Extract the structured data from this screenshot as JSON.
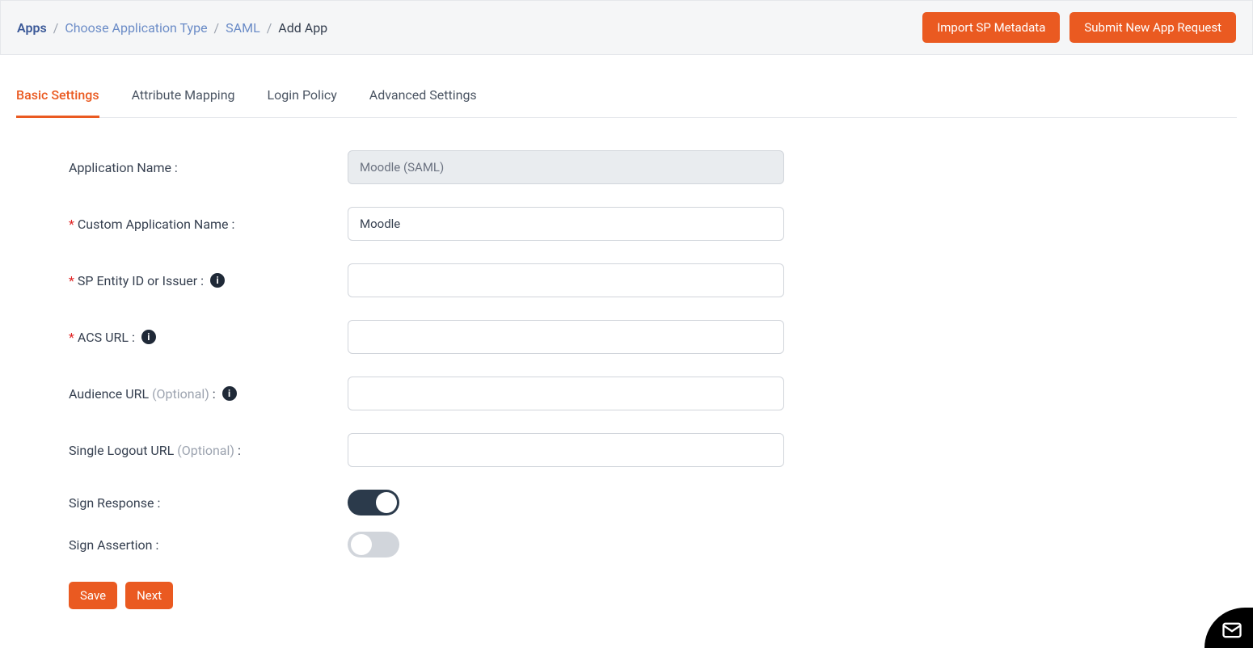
{
  "breadcrumb": {
    "apps": "Apps",
    "choose_type": "Choose Application Type",
    "saml": "SAML",
    "current": "Add App"
  },
  "header_buttons": {
    "import_metadata": "Import SP Metadata",
    "submit_request": "Submit New App Request"
  },
  "tabs": {
    "basic": "Basic Settings",
    "attribute": "Attribute Mapping",
    "login": "Login Policy",
    "advanced": "Advanced Settings"
  },
  "form": {
    "app_name": {
      "label": "Application Name :",
      "value": "Moodle (SAML)"
    },
    "custom_app_name": {
      "label": "Custom Application Name :",
      "value": "Moodle"
    },
    "sp_entity": {
      "label": "SP Entity ID or Issuer :",
      "value": ""
    },
    "acs_url": {
      "label": "ACS URL :",
      "value": ""
    },
    "audience_url": {
      "label_main": "Audience URL ",
      "label_opt": "(Optional)",
      "label_colon": " :",
      "value": ""
    },
    "single_logout": {
      "label_main": "Single Logout URL ",
      "label_opt": "(Optional)",
      "label_colon": " :",
      "value": ""
    },
    "sign_response": {
      "label": "Sign Response :"
    },
    "sign_assertion": {
      "label": "Sign Assertion :"
    }
  },
  "footer": {
    "save": "Save",
    "next": "Next"
  },
  "info_char": "i"
}
